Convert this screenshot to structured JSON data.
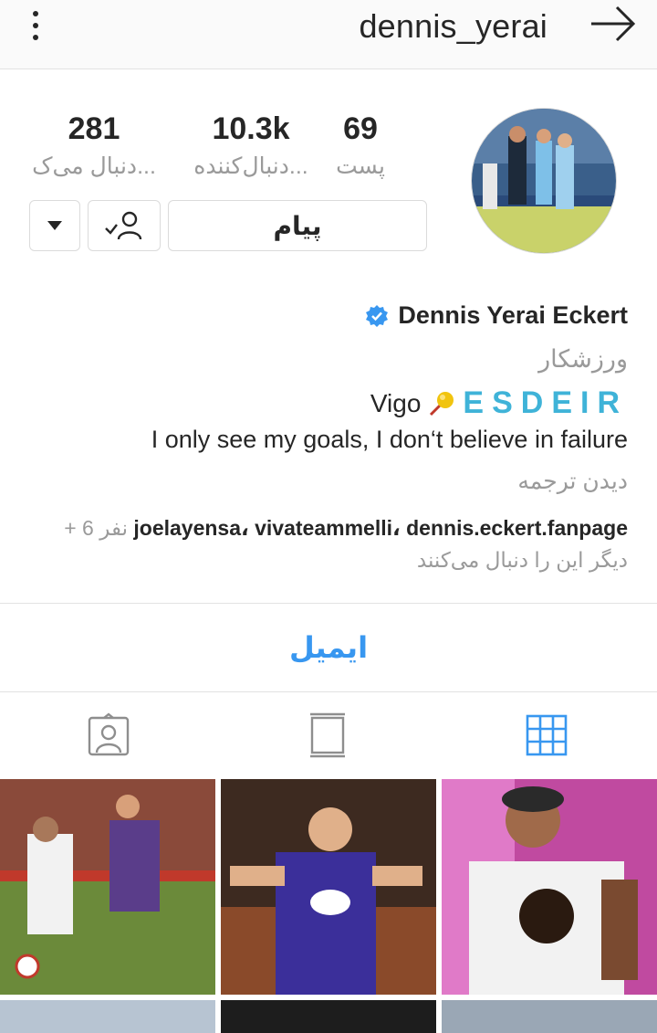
{
  "topbar": {
    "username": "dennis_yerai"
  },
  "profile": {
    "stats": {
      "posts_value": "69",
      "posts_label": "پست",
      "followers_value": "10.3k",
      "followers_label": "دنبال‌کننده...",
      "following_value": "281",
      "following_label": "دنبال می‌ک..."
    },
    "message_label": "پیام",
    "name": "Dennis Yerai Eckert",
    "category": "ورزشکار",
    "vigo_text": "Vigo",
    "esdeir_text": "ESDEIR",
    "quote": "I only see my goals, I don‘t believe in failure",
    "see_translation": "دیدن ترجمه",
    "followed_by_names": "joelayensa، vivateammelli، dennis.eckert.fanpage",
    "followed_by_more": "+ 6 نفر",
    "followed_by_line2": "دیگر این را دنبال می‌کنند"
  },
  "email_label": "ایمیل",
  "colors": {
    "accent": "#3897f0",
    "esdeir": "#3fb3d8",
    "verified": "#3897f0"
  }
}
